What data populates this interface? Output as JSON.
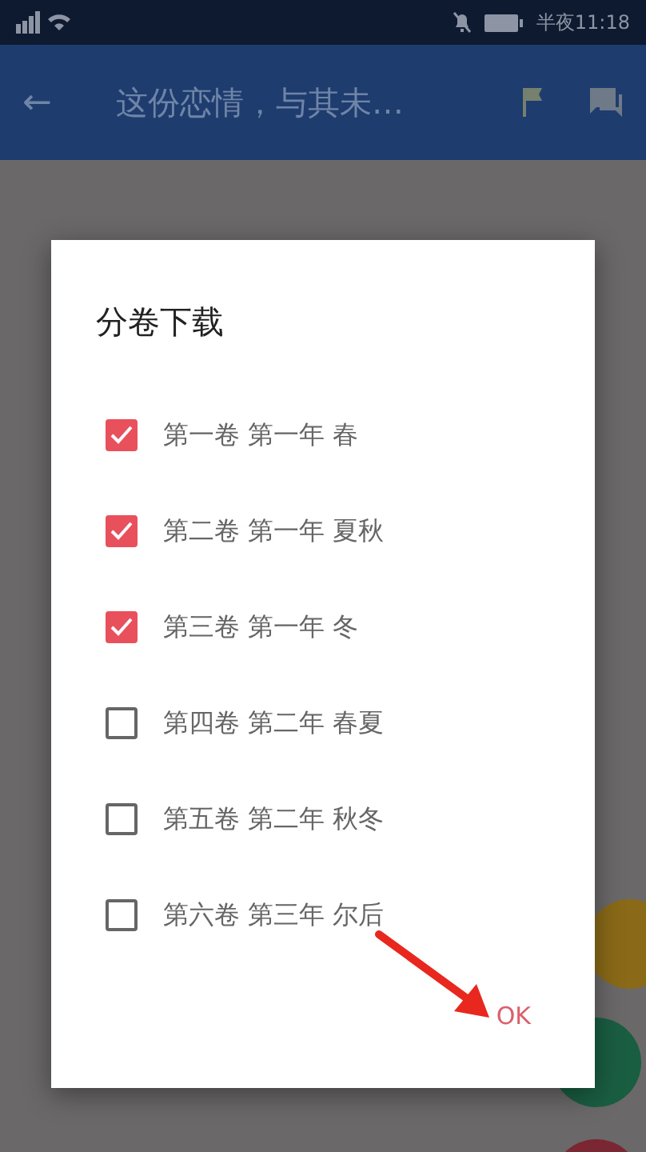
{
  "status_bar": {
    "time": "半夜11:18"
  },
  "app_bar": {
    "back": "←",
    "title": "这份恋情，与其未…"
  },
  "dialog": {
    "title": "分卷下载",
    "items": [
      {
        "label": "第一卷 第一年 春",
        "checked": true
      },
      {
        "label": "第二卷 第一年 夏秋",
        "checked": true
      },
      {
        "label": "第三卷 第一年 冬",
        "checked": true
      },
      {
        "label": "第四卷 第二年 春夏",
        "checked": false
      },
      {
        "label": "第五卷 第二年 秋冬",
        "checked": false
      },
      {
        "label": "第六卷 第三年 尔后",
        "checked": false
      }
    ],
    "ok_button": "OK"
  }
}
